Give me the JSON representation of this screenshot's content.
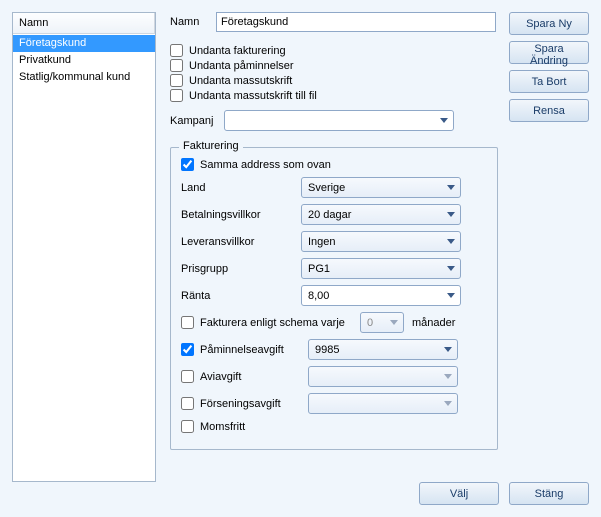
{
  "list": {
    "header": "Namn",
    "items": [
      "Företagskund",
      "Privatkund",
      "Statlig/kommunal kund"
    ],
    "selected_index": 0
  },
  "buttons": {
    "save_new": "Spara Ny",
    "save_change": "Spara Ändring",
    "delete": "Ta Bort",
    "clear": "Rensa",
    "choose": "Välj",
    "close": "Stäng"
  },
  "name": {
    "label": "Namn",
    "value": "Företagskund"
  },
  "excludes": {
    "billing": {
      "label": "Undanta fakturering",
      "checked": false
    },
    "reminder": {
      "label": "Undanta påminnelser",
      "checked": false
    },
    "massprint": {
      "label": "Undanta massutskrift",
      "checked": false
    },
    "massprint_file": {
      "label": "Undanta massutskrift till fil",
      "checked": false
    }
  },
  "campaign": {
    "label": "Kampanj",
    "value": ""
  },
  "invoicing": {
    "legend": "Fakturering",
    "same_address": {
      "label": "Samma address som ovan",
      "checked": true
    },
    "country": {
      "label": "Land",
      "value": "Sverige"
    },
    "payment_terms": {
      "label": "Betalningsvillkor",
      "value": "20 dagar"
    },
    "delivery_terms": {
      "label": "Leveransvillkor",
      "value": "Ingen"
    },
    "price_group": {
      "label": "Prisgrupp",
      "value": "PG1"
    },
    "interest": {
      "label": "Ränta",
      "value": "8,00"
    },
    "schedule": {
      "label": "Fakturera enligt schema varje",
      "value": "0",
      "suffix": "månader",
      "checked": false
    },
    "reminder_fee": {
      "label": "Påminnelseavgift",
      "value": "9985",
      "checked": true
    },
    "avi_fee": {
      "label": "Aviavgift",
      "value": "",
      "checked": false
    },
    "late_fee": {
      "label": "Förseningsavgift",
      "value": "",
      "checked": false
    },
    "vat_free": {
      "label": "Momsfritt",
      "checked": false
    }
  }
}
